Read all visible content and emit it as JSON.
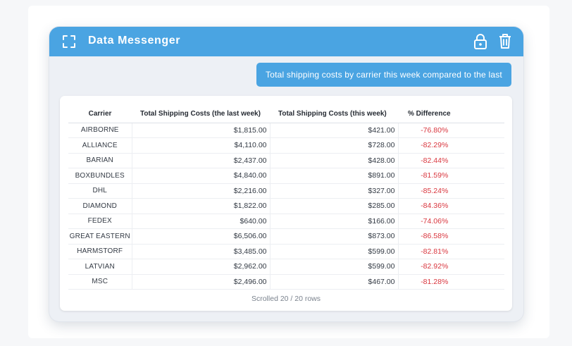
{
  "window": {
    "title": "Data Messenger"
  },
  "icons": {
    "expand": "expand-icon",
    "lock": "lock-icon",
    "trash": "trash-icon"
  },
  "colors": {
    "accent": "#4aa4e2",
    "negative": "#d9363e"
  },
  "message": {
    "text": "Total shipping costs by carrier this week compared to the last"
  },
  "table": {
    "columns": [
      "Carrier",
      "Total Shipping Costs (the last week)",
      "Total Shipping Costs (this week)",
      "% Difference"
    ],
    "rows": [
      [
        "AIRBORNE",
        "$1,815.00",
        "$421.00",
        "-76.80%"
      ],
      [
        "ALLIANCE",
        "$4,110.00",
        "$728.00",
        "-82.29%"
      ],
      [
        "BARIAN",
        "$2,437.00",
        "$428.00",
        "-82.44%"
      ],
      [
        "BOXBUNDLES",
        "$4,840.00",
        "$891.00",
        "-81.59%"
      ],
      [
        "DHL",
        "$2,216.00",
        "$327.00",
        "-85.24%"
      ],
      [
        "DIAMOND",
        "$1,822.00",
        "$285.00",
        "-84.36%"
      ],
      [
        "FEDEX",
        "$640.00",
        "$166.00",
        "-74.06%"
      ],
      [
        "GREAT EASTERN",
        "$6,506.00",
        "$873.00",
        "-86.58%"
      ],
      [
        "HARMSTORF",
        "$3,485.00",
        "$599.00",
        "-82.81%"
      ],
      [
        "LATVIAN",
        "$2,962.00",
        "$599.00",
        "-82.92%"
      ],
      [
        "MSC",
        "$2,496.00",
        "$467.00",
        "-81.28%"
      ]
    ],
    "footer": "Scrolled 20 / 20 rows"
  }
}
